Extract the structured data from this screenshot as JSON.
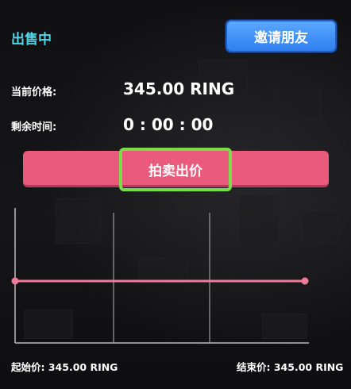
{
  "status_label": "出售中",
  "invite_button_label": "邀请朋友",
  "price": {
    "label": "当前价格:",
    "value": "345.00 RING"
  },
  "time": {
    "label": "剩余时间:",
    "value": "0 : 00 : 00"
  },
  "bid_button_label": "拍卖出价",
  "footer": {
    "start": "起始价: 345.00 RING",
    "end": "结束价: 345.00 RING"
  },
  "colors": {
    "accent": "#55d4e6",
    "bid": "#ea5a7d",
    "highlight": "#7bdc4a",
    "invite": "#2f7ff0",
    "line": "#f07a9a"
  },
  "chart_data": {
    "type": "line",
    "series": [
      {
        "values": [
          345.0,
          345.0
        ]
      }
    ],
    "x": [
      0,
      1
    ],
    "grid": true
  }
}
